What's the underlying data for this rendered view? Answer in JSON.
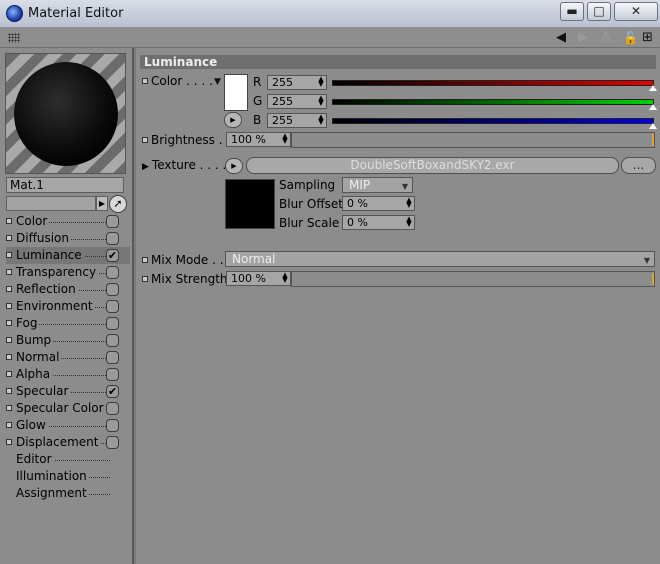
{
  "window": {
    "title": "Material Editor",
    "minimize": "▬",
    "maximize": "□",
    "close": "✕"
  },
  "toolbar": {
    "back_icon": "◀",
    "forward_icon": "▶",
    "text_icon": "A",
    "lock_icon": "🔓",
    "new_icon": "⊞"
  },
  "material": {
    "name": "Mat.1"
  },
  "channels": [
    {
      "label": "Color",
      "checked": false,
      "has_box": true,
      "has_dot": true
    },
    {
      "label": "Diffusion",
      "checked": false,
      "has_box": true,
      "has_dot": true
    },
    {
      "label": "Luminance",
      "checked": true,
      "has_box": true,
      "has_dot": true,
      "active": true
    },
    {
      "label": "Transparency",
      "checked": false,
      "has_box": true,
      "has_dot": true
    },
    {
      "label": "Reflection",
      "checked": false,
      "has_box": true,
      "has_dot": true
    },
    {
      "label": "Environment",
      "checked": false,
      "has_box": true,
      "has_dot": true
    },
    {
      "label": "Fog",
      "checked": false,
      "has_box": true,
      "has_dot": true
    },
    {
      "label": "Bump",
      "checked": false,
      "has_box": true,
      "has_dot": true
    },
    {
      "label": "Normal",
      "checked": false,
      "has_box": true,
      "has_dot": true
    },
    {
      "label": "Alpha",
      "checked": false,
      "has_box": true,
      "has_dot": true
    },
    {
      "label": "Specular",
      "checked": true,
      "has_box": true,
      "has_dot": true
    },
    {
      "label": "Specular Color",
      "checked": false,
      "has_box": true,
      "has_dot": true
    },
    {
      "label": "Glow",
      "checked": false,
      "has_box": true,
      "has_dot": true
    },
    {
      "label": "Displacement",
      "checked": false,
      "has_box": true,
      "has_dot": true
    },
    {
      "label": "Editor",
      "checked": false,
      "has_box": false,
      "has_dot": false
    },
    {
      "label": "Illumination",
      "checked": false,
      "has_box": false,
      "has_dot": false
    },
    {
      "label": "Assignment",
      "checked": false,
      "has_box": false,
      "has_dot": false
    }
  ],
  "luminance": {
    "header": "Luminance",
    "color_label": "Color . . . .",
    "r_label": "R",
    "g_label": "G",
    "b_label": "B",
    "r_value": "255",
    "g_value": "255",
    "b_value": "255",
    "brightness_label": "Brightness . .",
    "brightness_value": "100 %",
    "texture_label": "Texture . . . .",
    "texture_file": "DoubleSoftBoxandSKY2.exr",
    "texture_more": "...",
    "sampling_label": "Sampling",
    "sampling_value": "MIP",
    "blur_offset_label": "Blur Offset",
    "blur_offset_value": "0 %",
    "blur_scale_label": "Blur Scale",
    "blur_scale_value": "0 %",
    "mix_mode_label": "Mix Mode . .",
    "mix_mode_value": "Normal",
    "mix_strength_label": "Mix Strength",
    "mix_strength_value": "100 %"
  },
  "colors": {
    "red": "#e00000",
    "green": "#00d000",
    "blue": "#0000e0",
    "accent": "#d9a53a"
  }
}
